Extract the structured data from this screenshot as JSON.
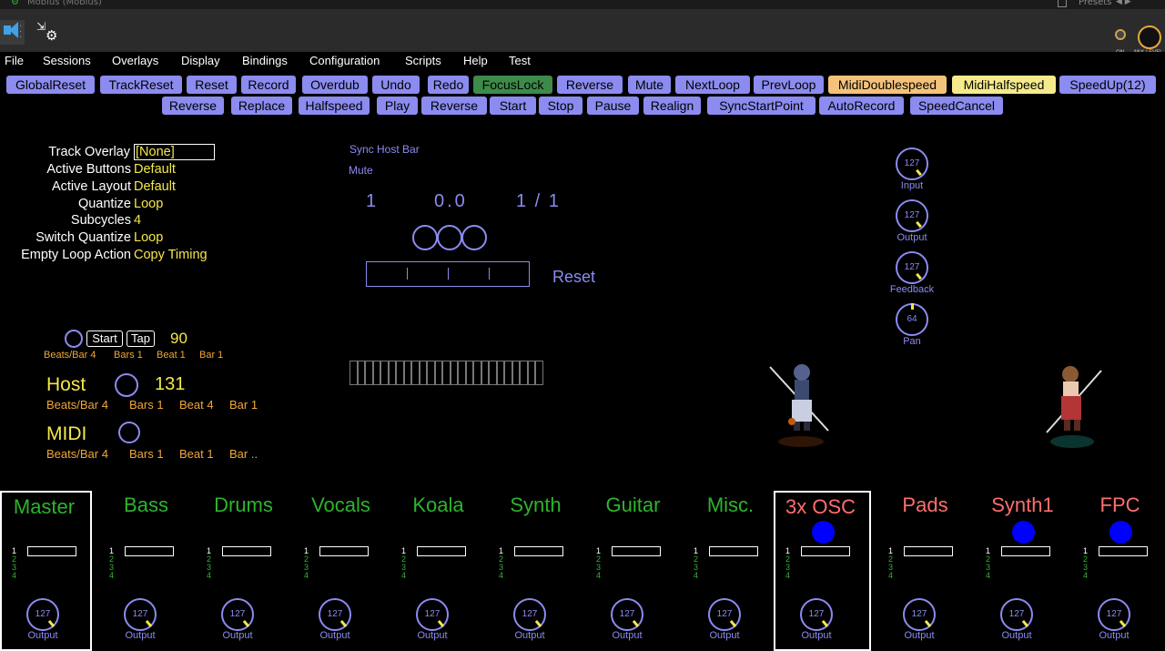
{
  "window": {
    "title": "Mobius (Mobius)",
    "presets_label": "Presets"
  },
  "toolbar": {
    "on_label": "ON",
    "mix_label": "MIX LEVEL"
  },
  "menu": [
    "File",
    "Sessions",
    "Overlays",
    "Display",
    "Bindings",
    "Configuration",
    "Scripts",
    "Help",
    "Test"
  ],
  "buttons_row1": [
    {
      "label": "GlobalReset",
      "style": "normal"
    },
    {
      "label": "TrackReset",
      "style": "normal"
    },
    {
      "label": "Reset",
      "style": "normal"
    },
    {
      "label": "Record",
      "style": "normal"
    },
    {
      "label": "Overdub",
      "style": "normal"
    },
    {
      "label": "Undo",
      "style": "normal"
    },
    {
      "label": "Redo",
      "style": "normal"
    },
    {
      "label": "FocusLock",
      "style": "green"
    },
    {
      "label": "Reverse",
      "style": "normal"
    },
    {
      "label": "Mute",
      "style": "normal"
    },
    {
      "label": "NextLoop",
      "style": "normal"
    },
    {
      "label": "PrevLoop",
      "style": "normal"
    },
    {
      "label": "MidiDoublespeed",
      "style": "orange"
    },
    {
      "label": "MidiHalfspeed",
      "style": "yellow"
    },
    {
      "label": "SpeedUp(12)",
      "style": "normal"
    }
  ],
  "buttons_row2": [
    {
      "label": "Reverse"
    },
    {
      "label": "Replace"
    },
    {
      "label": "Halfspeed"
    },
    {
      "label": "Play"
    },
    {
      "label": "Reverse"
    },
    {
      "label": "Start"
    },
    {
      "label": "Stop"
    },
    {
      "label": "Pause"
    },
    {
      "label": "Realign"
    },
    {
      "label": "SyncStartPoint"
    },
    {
      "label": "AutoRecord"
    },
    {
      "label": "SpeedCancel"
    }
  ],
  "info": {
    "track_overlay": {
      "label": "Track Overlay",
      "value": "[None]"
    },
    "active_buttons": {
      "label": "Active Buttons",
      "value": "Default"
    },
    "active_layout": {
      "label": "Active Layout",
      "value": "Default"
    },
    "quantize": {
      "label": "Quantize",
      "value": "Loop"
    },
    "subcycles": {
      "label": "Subcycles",
      "value": "4"
    },
    "switch_quantize": {
      "label": "Switch Quantize",
      "value": "Loop"
    },
    "empty_loop_action": {
      "label": "Empty Loop Action",
      "value": "Copy Timing"
    }
  },
  "center": {
    "sync_host_bar": "Sync Host Bar",
    "mute": "Mute",
    "loop_number": "1",
    "position": "0.0",
    "cycle": "1 / 1",
    "mode": "Reset"
  },
  "knobs": [
    {
      "value": "127",
      "label": "Input",
      "level": 1.0
    },
    {
      "value": "127",
      "label": "Output",
      "level": 1.0
    },
    {
      "value": "127",
      "label": "Feedback",
      "level": 1.0
    },
    {
      "value": "64",
      "label": "Pan",
      "level": 0.5
    }
  ],
  "transport": {
    "start_label": "Start",
    "tap_label": "Tap",
    "tempo": "90",
    "beats_per_bar": "Beats/Bar 4",
    "bars": "Bars 1",
    "beat": "Beat 1",
    "bar": "Bar 1"
  },
  "host": {
    "title": "Host",
    "tempo": "131",
    "beats_per_bar": "Beats/Bar 4",
    "bars": "Bars 1",
    "beat": "Beat 4",
    "bar": "Bar 1"
  },
  "midi": {
    "title": "MIDI",
    "beats_per_bar": "Beats/Bar 4",
    "bars": "Bars 1",
    "beat": "Beat 1",
    "bar": "Bar .."
  },
  "tracks": [
    {
      "name": "Master",
      "color": "green",
      "selected": true,
      "active": false,
      "knob": "127",
      "out": "Output"
    },
    {
      "name": "Bass",
      "color": "green",
      "selected": false,
      "active": false,
      "knob": "127",
      "out": "Output"
    },
    {
      "name": "Drums",
      "color": "green",
      "selected": false,
      "active": false,
      "knob": "127",
      "out": "Output"
    },
    {
      "name": "Vocals",
      "color": "green",
      "selected": false,
      "active": false,
      "knob": "127",
      "out": "Output"
    },
    {
      "name": "Koala",
      "color": "green",
      "selected": false,
      "active": false,
      "knob": "127",
      "out": "Output"
    },
    {
      "name": "Synth",
      "color": "green",
      "selected": false,
      "active": false,
      "knob": "127",
      "out": "Output"
    },
    {
      "name": "Guitar",
      "color": "green",
      "selected": false,
      "active": false,
      "knob": "127",
      "out": "Output"
    },
    {
      "name": "Misc.",
      "color": "green",
      "selected": false,
      "active": false,
      "knob": "127",
      "out": "Output"
    },
    {
      "name": "3x OSC",
      "color": "red",
      "selected": true,
      "active": true,
      "knob": "127",
      "out": "Output"
    },
    {
      "name": "Pads",
      "color": "red",
      "selected": false,
      "active": false,
      "knob": "127",
      "out": "Output"
    },
    {
      "name": "Synth1",
      "color": "red",
      "selected": false,
      "active": true,
      "knob": "127",
      "out": "Output"
    },
    {
      "name": "FPC",
      "color": "red",
      "selected": false,
      "active": true,
      "knob": "127",
      "out": "Output"
    }
  ],
  "loop_numbers": [
    "1",
    "2",
    "3",
    "4"
  ]
}
